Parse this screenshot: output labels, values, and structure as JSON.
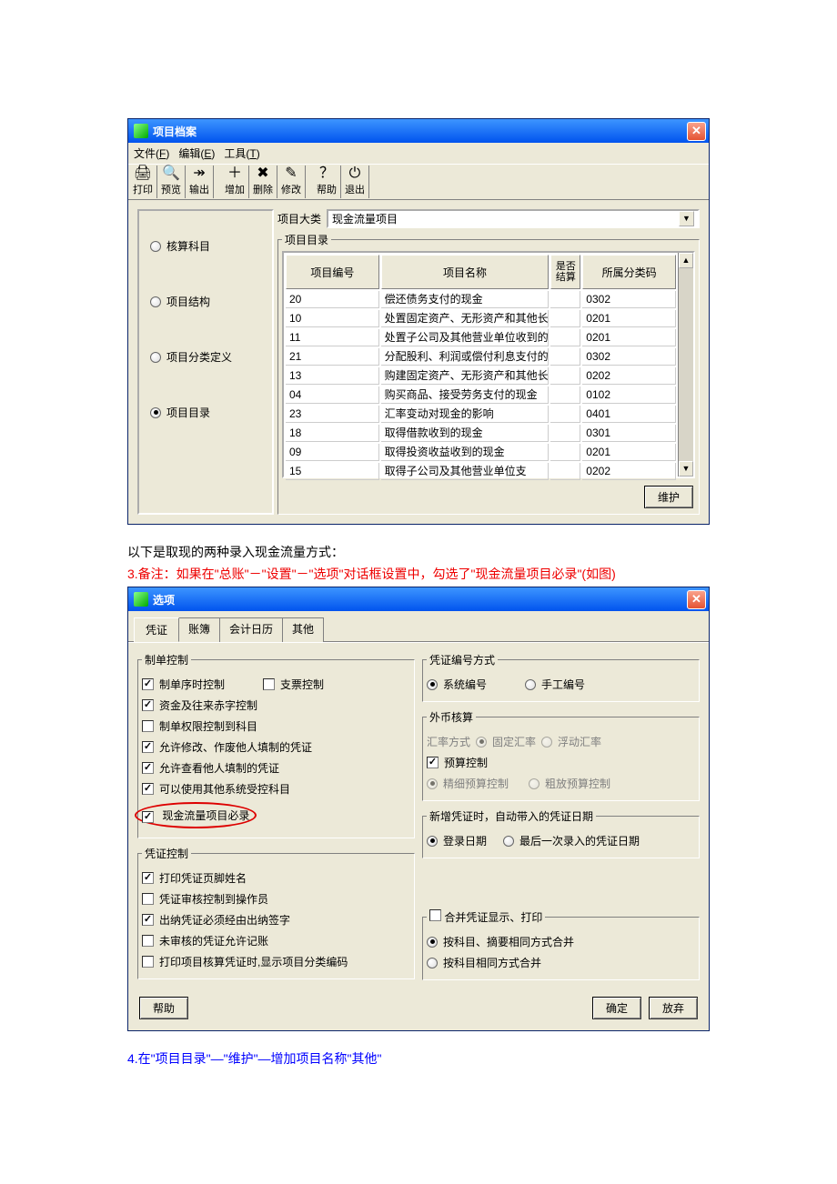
{
  "win1": {
    "title": "项目档案",
    "menu": {
      "file": "文件",
      "file_accel": "F",
      "edit": "编辑",
      "edit_accel": "E",
      "tool": "工具",
      "tool_accel": "T"
    },
    "toolbar": {
      "print": "打印",
      "preview": "预览",
      "output": "输出",
      "add": "增加",
      "delete": "删除",
      "modify": "修改",
      "help": "帮助",
      "exit": "退出"
    },
    "left": {
      "r1": "核算科目",
      "r2": "项目结构",
      "r3": "项目分类定义",
      "r4": "项目目录"
    },
    "label_category": "项目大类",
    "category_value": "现金流量项目",
    "group_title": "项目目录",
    "cols": {
      "code": "项目编号",
      "name": "项目名称",
      "jiesuan": "是否结算",
      "cat": "所属分类码"
    },
    "rows": [
      {
        "code": "20",
        "name": "偿还债务支付的现金",
        "cat": "0302"
      },
      {
        "code": "10",
        "name": "处置固定资产、无形资产和其他长期资产收回的现金净额",
        "cat": "0201"
      },
      {
        "code": "11",
        "name": "处置子公司及其他营业单位收到的现金净额",
        "cat": "0201"
      },
      {
        "code": "21",
        "name": "分配股利、利润或偿付利息支付的现金",
        "cat": "0302"
      },
      {
        "code": "13",
        "name": "购建固定资产、无形资产和其他长期资产支付的现金",
        "cat": "0202"
      },
      {
        "code": "04",
        "name": "购买商品、接受劳务支付的现金",
        "cat": "0102"
      },
      {
        "code": "23",
        "name": "汇率变动对现金的影响",
        "cat": "0401"
      },
      {
        "code": "18",
        "name": "取得借款收到的现金",
        "cat": "0301"
      },
      {
        "code": "09",
        "name": "取得投资收益收到的现金",
        "cat": "0201"
      },
      {
        "code": "15",
        "name": "取得子公司及其他营业单位支",
        "cat": "0202"
      }
    ],
    "maintain_btn": "维护"
  },
  "text_between": "以下是取现的两种录入现金流量方式：",
  "note3": "3.备注：如果在\"总账\"－\"设置\"－\"选项\"对话框设置中，勾选了\"现金流量项目必录\"(如图)",
  "win2": {
    "title": "选项",
    "tabs": {
      "t1": "凭证",
      "t2": "账簿",
      "t3": "会计日历",
      "t4": "其他"
    },
    "grp": {
      "zhidan": "制单控制",
      "pzkz": "凭证控制",
      "numbering": "凭证编号方式",
      "currency": "外币核算",
      "newdate": "新增凭证时，自动带入的凭证日期",
      "merge": "合并凭证显示、打印"
    },
    "chk": {
      "seq": "制单序时控制",
      "cheque": "支票控制",
      "fund": "资金及往来赤字控制",
      "priv": "制单权限控制到科目",
      "modify": "允许修改、作废他人填制的凭证",
      "view": "允许查看他人填制的凭证",
      "othersys": "可以使用其他系统受控科目",
      "cashmust": "现金流量项目必录",
      "footer": "打印凭证页脚姓名",
      "audit": "凭证审核控制到操作员",
      "cashier": "出纳凭证必须经由出纳签字",
      "unaudit": "未审核的凭证允许记账",
      "printcat": "打印项目核算凭证时,显示项目分类编码",
      "budget": "预算控制"
    },
    "rad": {
      "sysnum": "系统编号",
      "mannum": "手工编号",
      "hlfs": "汇率方式",
      "fixedrate": "固定汇率",
      "floatrate": "浮动汇率",
      "fine": "精细预算控制",
      "loose": "粗放预算控制",
      "login": "登录日期",
      "last": "最后一次录入的凭证日期",
      "merge1": "按科目、摘要相同方式合并",
      "merge2": "按科目相同方式合并"
    },
    "btn": {
      "help": "帮助",
      "ok": "确定",
      "cancel": "放弃"
    }
  },
  "note4": "4.在\"项目目录\"—\"维护\"—增加项目名称\"其他\""
}
